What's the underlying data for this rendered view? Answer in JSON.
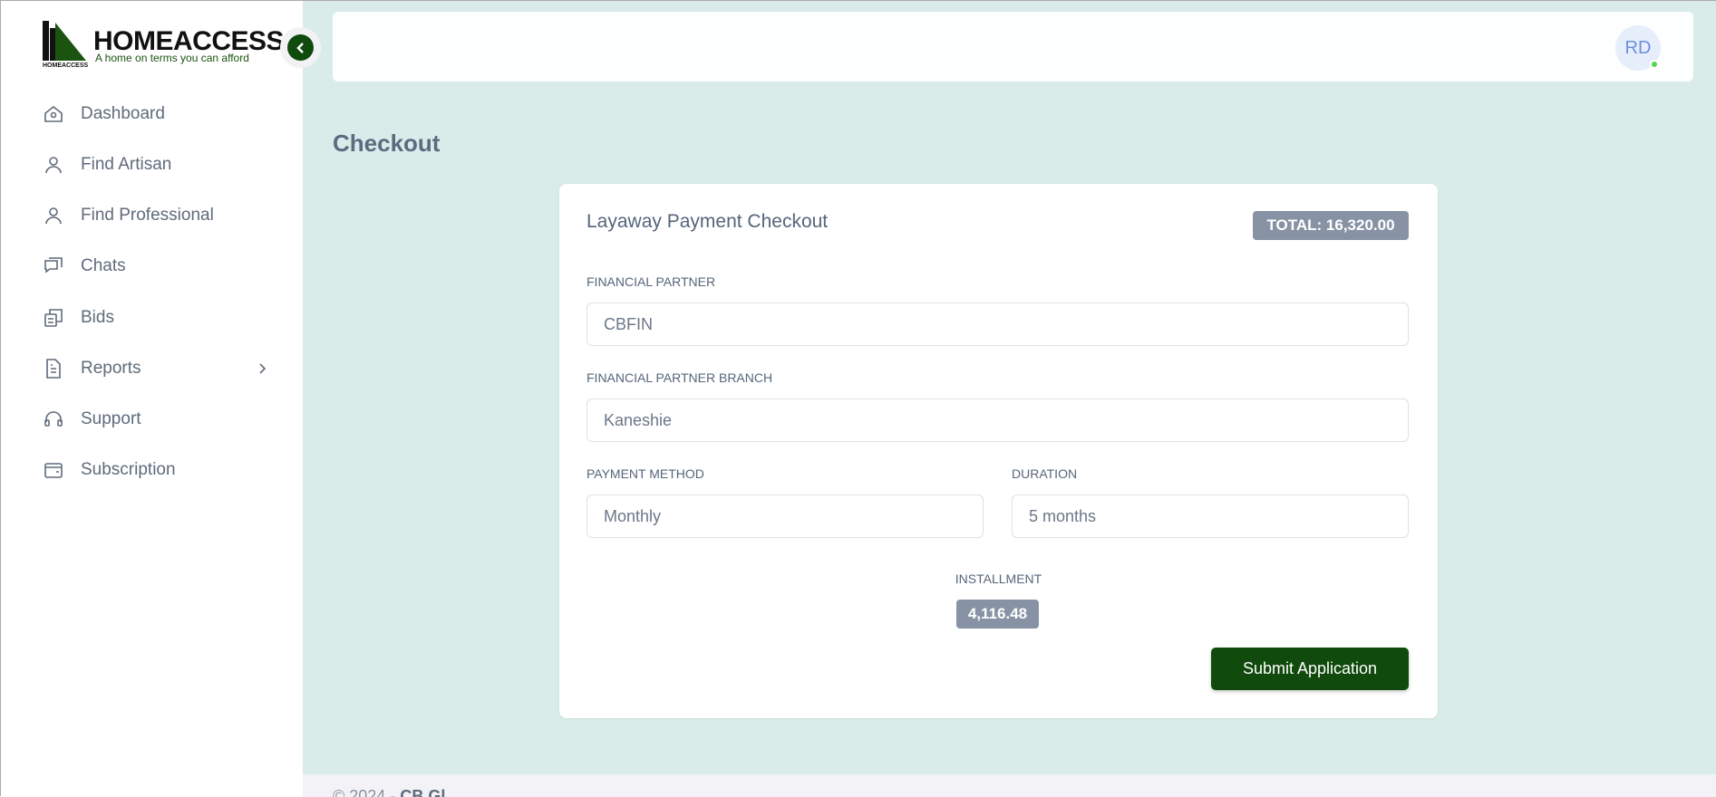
{
  "brand": {
    "name": "HOMEACCESS",
    "tagline": "A home on terms you can afford",
    "small": "HOMEACCESS"
  },
  "sidebar": {
    "items": [
      {
        "label": "Dashboard",
        "icon": "home-icon"
      },
      {
        "label": "Find Artisan",
        "icon": "user-icon"
      },
      {
        "label": "Find Professional",
        "icon": "user-icon"
      },
      {
        "label": "Chats",
        "icon": "chat-icon"
      },
      {
        "label": "Bids",
        "icon": "copy-icon"
      },
      {
        "label": "Reports",
        "icon": "document-icon"
      },
      {
        "label": "Support",
        "icon": "headset-icon"
      },
      {
        "label": "Subscription",
        "icon": "wallet-icon"
      }
    ]
  },
  "header": {
    "avatar_initials": "RD",
    "online_color": "#56d34f"
  },
  "page": {
    "title": "Checkout"
  },
  "checkout": {
    "title": "Layaway Payment Checkout",
    "total": "TOTAL: 16,320.00",
    "financial_partner_label": "FINANCIAL PARTNER",
    "financial_partner": "CBFIN",
    "branch_label": "FINANCIAL PARTNER BRANCH",
    "branch": "Kaneshie",
    "payment_method_label": "PAYMENT METHOD",
    "payment_method": "Monthly",
    "duration_label": "DURATION",
    "duration": "5 months",
    "installment_label": "INSTALLMENT",
    "installment": "4,116.48",
    "submit_label": "Submit Application"
  },
  "footer": {
    "prefix": "© 2024 -",
    "company": "CB Gl"
  },
  "colors": {
    "brand_green": "#114a0d",
    "background": "#d9ece9",
    "badge": "#8793a4"
  }
}
